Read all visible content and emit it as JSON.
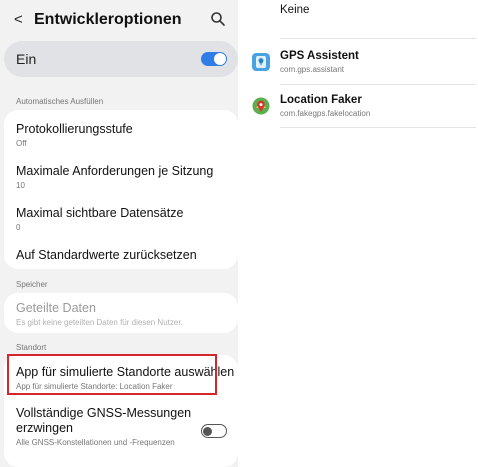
{
  "left": {
    "header": {
      "back_icon": "<",
      "title": "Entwickleroptionen",
      "search_icon": "search-icon"
    },
    "master_switch": {
      "label": "Ein",
      "state": "on"
    },
    "sections": {
      "autofill": "Automatisches Ausfüllen",
      "storage": "Speicher",
      "location": "Standort"
    },
    "autofill_items": [
      {
        "title": "Protokollierungsstufe",
        "subtitle": "Off"
      },
      {
        "title": "Maximale Anforderungen je Sitzung",
        "subtitle": "10"
      },
      {
        "title": "Maximal sichtbare Datensätze",
        "subtitle": "0"
      },
      {
        "title": "Auf Standardwerte zurücksetzen"
      }
    ],
    "storage_item": {
      "title": "Geteilte Daten",
      "subtitle": "Es gibt keine geteilten Daten für diesen Nutzer."
    },
    "location_items": [
      {
        "title": "App für simulierte Standorte auswählen",
        "subtitle": "App für simulierte Standorte: Location Faker"
      },
      {
        "title_line1": "Vollständige GNSS-Messungen",
        "title_line2": "erzwingen",
        "subtitle": "Alle GNSS-Konstellationen und -Frequenzen",
        "state": "off"
      }
    ],
    "highlight_color": "#d4262b",
    "toggle_on_color": "#2f7ee8"
  },
  "right": {
    "none_option": "Keine",
    "apps": [
      {
        "name": "GPS Assistent",
        "package": "com.gps.assistant",
        "icon": "gps-assistant-app-icon"
      },
      {
        "name": "Location Faker",
        "package": "com.fakegps.fakelocation",
        "icon": "location-faker-app-icon"
      }
    ]
  }
}
